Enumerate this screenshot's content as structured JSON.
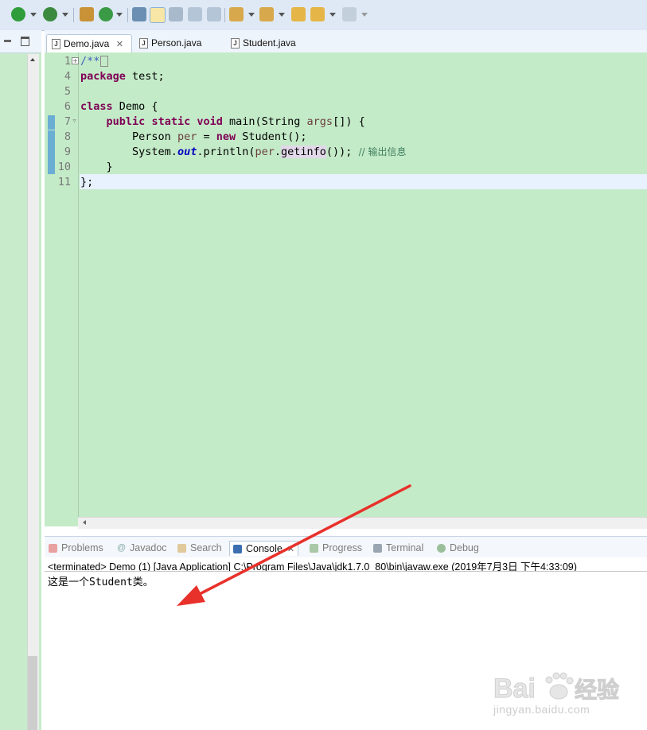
{
  "toolbar": {
    "icons": [
      "run-icon",
      "debug-icon",
      "build-icon",
      "refresh-icon",
      "search-icon",
      "brush-icon",
      "toggle-icon",
      "block-icon",
      "pilcrow-icon",
      "annotation-icon",
      "prev-annotation-icon",
      "back-icon",
      "forward-icon"
    ]
  },
  "editor": {
    "tabs": [
      {
        "label": "Demo.java",
        "active": true
      },
      {
        "label": "Person.java",
        "active": false
      },
      {
        "label": "Student.java",
        "active": false
      }
    ],
    "line_numbers": [
      "1",
      "4",
      "5",
      "6",
      "7",
      "8",
      "9",
      "10",
      "11"
    ],
    "code": {
      "l1": "/**",
      "l4_kw": "package",
      "l4_rest": " test;",
      "l6_kw": "class",
      "l6_rest": " Demo {",
      "l7_indent": "    ",
      "l7_kw1": "public",
      "l7_kw2": "static",
      "l7_kw3": "void",
      "l7_rest": " main(String ",
      "l7_var": "args",
      "l7_end": "[]) {",
      "l8_indent": "        ",
      "l8_a": "Person ",
      "l8_var": "per",
      "l8_b": " = ",
      "l8_kw": "new",
      "l8_c": " Student();",
      "l9_indent": "        ",
      "l9_a": "System.",
      "l9_field": "out",
      "l9_b": ".println(",
      "l9_var": "per",
      "l9_c": ".",
      "l9_hl": "getinfo",
      "l9_d": "()); ",
      "l9_comment": "// 输出信息",
      "l10": "    }",
      "l11": "};"
    }
  },
  "console": {
    "tabs": [
      {
        "label": "Problems",
        "icon": "problems-icon"
      },
      {
        "label": "Javadoc",
        "icon": "at-icon"
      },
      {
        "label": "Search",
        "icon": "search-flashlight-icon"
      },
      {
        "label": "Console",
        "icon": "console-icon",
        "active": true
      },
      {
        "label": "Progress",
        "icon": "progress-icon"
      },
      {
        "label": "Terminal",
        "icon": "terminal-icon"
      },
      {
        "label": "Debug",
        "icon": "debug-bug-icon"
      }
    ],
    "status": "<terminated> Demo (1) [Java Application] C:\\Program Files\\Java\\jdk1.7.0_80\\bin\\javaw.exe (2019年7月3日 下午4:33:09)",
    "output": "这是一个Student类。"
  },
  "watermark": {
    "brand": "Bai",
    "brand_suffix": "经验",
    "url": "jingyan.baidu.com"
  },
  "colors": {
    "editor_bg": "#c4ebc8",
    "keyword": "#7f0055",
    "comment": "#3f7f5f",
    "annotation_arrow": "#e8312b"
  }
}
